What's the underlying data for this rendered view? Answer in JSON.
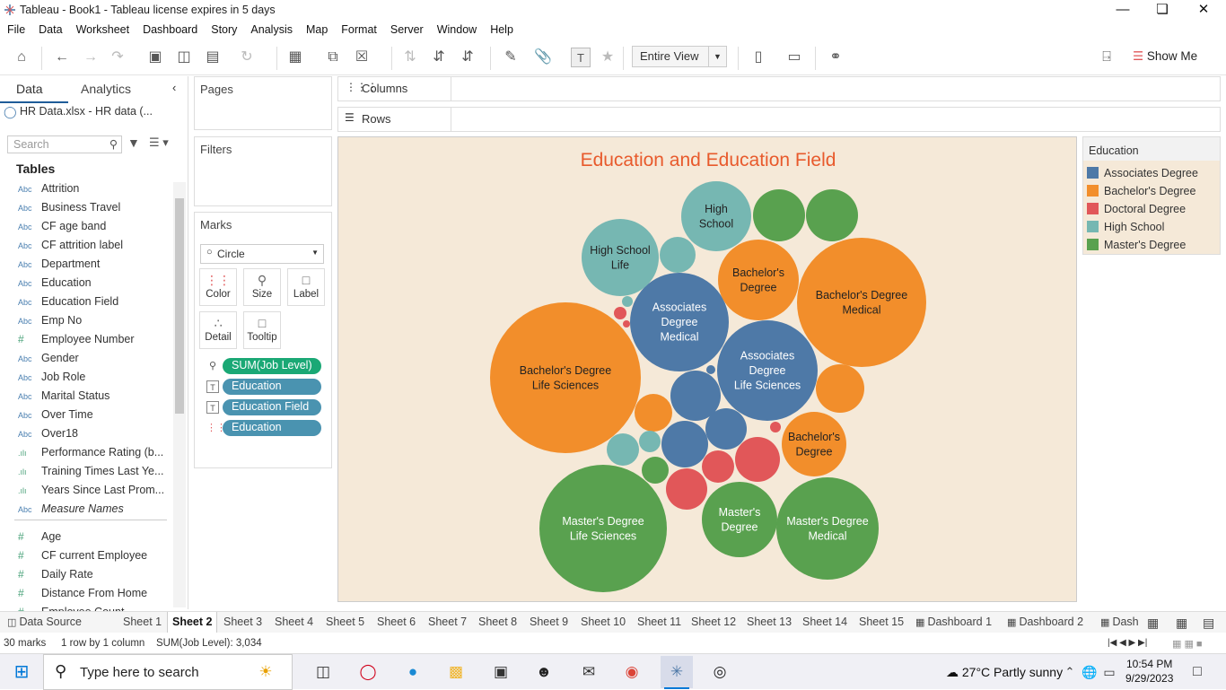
{
  "window": {
    "title": "Tableau - Book1 - Tableau license expires in 5 days"
  },
  "menu": [
    "File",
    "Data",
    "Worksheet",
    "Dashboard",
    "Story",
    "Analysis",
    "Map",
    "Format",
    "Server",
    "Window",
    "Help"
  ],
  "toolbar": {
    "view_mode": "Entire View",
    "show_me": "Show Me"
  },
  "left_panel": {
    "tab_data": "Data",
    "tab_analytics": "Analytics",
    "datasource": "HR Data.xlsx - HR data (...",
    "search_placeholder": "Search",
    "tables_heading": "Tables",
    "fields": [
      {
        "type": "Abc",
        "name": "Attrition"
      },
      {
        "type": "Abc",
        "name": "Business Travel"
      },
      {
        "type": "Abc",
        "name": "CF age band"
      },
      {
        "type": "Abc",
        "name": "CF attrition label"
      },
      {
        "type": "Abc",
        "name": "Department"
      },
      {
        "type": "Abc",
        "name": "Education"
      },
      {
        "type": "Abc",
        "name": "Education Field"
      },
      {
        "type": "Abc",
        "name": "Emp No"
      },
      {
        "type": "#",
        "name": "Employee Number"
      },
      {
        "type": "Abc",
        "name": "Gender"
      },
      {
        "type": "Abc",
        "name": "Job Role"
      },
      {
        "type": "Abc",
        "name": "Marital Status"
      },
      {
        "type": "Abc",
        "name": "Over Time"
      },
      {
        "type": "Abc",
        "name": "Over18"
      },
      {
        "type": ".ılı",
        "name": "Performance Rating (b..."
      },
      {
        "type": ".ılı",
        "name": "Training Times Last Ye..."
      },
      {
        "type": ".ılı",
        "name": "Years Since Last Prom..."
      },
      {
        "type": "Abc",
        "name": "Measure Names"
      },
      {
        "type": "#",
        "name": "Age"
      },
      {
        "type": "#",
        "name": "CF current Employee"
      },
      {
        "type": "#",
        "name": "Daily Rate"
      },
      {
        "type": "#",
        "name": "Distance From Home"
      },
      {
        "type": "#",
        "name": "Employee Count"
      }
    ]
  },
  "shelves": {
    "pages": "Pages",
    "filters": "Filters",
    "marks": "Marks",
    "columns": "Columns",
    "rows": "Rows",
    "mark_type": "Circle"
  },
  "marks_buttons": [
    "Color",
    "Size",
    "Label",
    "Detail",
    "Tooltip"
  ],
  "marks_pills": [
    {
      "label": "SUM(Job Level)",
      "color": "#1aa875"
    },
    {
      "label": "Education",
      "color": "#4a93b0"
    },
    {
      "label": "Education Field",
      "color": "#4a93b0"
    },
    {
      "label": "Education",
      "color": "#4a93b0"
    }
  ],
  "legend": {
    "title": "Education",
    "items": [
      {
        "label": "Associates Degree",
        "color": "#4e79a7"
      },
      {
        "label": "Bachelor's Degree",
        "color": "#f28e2b"
      },
      {
        "label": "Doctoral Degree",
        "color": "#e15759"
      },
      {
        "label": "High School",
        "color": "#76b7b2"
      },
      {
        "label": "Master's Degree",
        "color": "#59a14f"
      }
    ]
  },
  "chart_data": {
    "type": "bubble",
    "title": "Education and Education Field",
    "size_measure": "SUM(Job Level)",
    "total": "3,034",
    "mark_count": 30,
    "bubbles": [
      {
        "education": "Bachelor's Degree",
        "field": "Life Sciences",
        "label": "Bachelor's Degree\nLife Sciences",
        "size": 100
      },
      {
        "education": "Bachelor's Degree",
        "field": "Medical",
        "label": "Bachelor's Degree\nMedical",
        "size": 72
      },
      {
        "education": "Master's Degree",
        "field": "Life Sciences",
        "label": "Master's Degree\nLife Sciences",
        "size": 72
      },
      {
        "education": "Master's Degree",
        "field": "Medical",
        "label": "Master's Degree\nMedical",
        "size": 46
      },
      {
        "education": "Associates Degree",
        "field": "Medical",
        "label": "Associates\nDegree\nMedical",
        "size": 42
      },
      {
        "education": "Associates Degree",
        "field": "Life Sciences",
        "label": "Associates\nDegree\nLife Sciences",
        "size": 44
      },
      {
        "education": "Bachelor's Degree",
        "field": "",
        "label": "Bachelor's\nDegree",
        "size": 28
      },
      {
        "education": "Bachelor's Degree",
        "field": "",
        "label": "Bachelor's\nDegree",
        "size": 20
      },
      {
        "education": "Master's Degree",
        "field": "",
        "label": "Master's\nDegree",
        "size": 24
      },
      {
        "education": "High School",
        "field": "",
        "label": "High\nSchool",
        "size": 21
      },
      {
        "education": "High School",
        "field": "Life",
        "label": "High School\nLife",
        "size": 26
      },
      {
        "education": "Master's Degree",
        "field": "",
        "label": "",
        "size": 12
      },
      {
        "education": "Master's Degree",
        "field": "",
        "label": "",
        "size": 12
      },
      {
        "education": "Bachelor's Degree",
        "field": "",
        "label": "",
        "size": 10
      },
      {
        "education": "Associates Degree",
        "field": "",
        "label": "",
        "size": 11
      },
      {
        "education": "Associates Degree",
        "field": "",
        "label": "",
        "size": 9
      },
      {
        "education": "Associates Degree",
        "field": "",
        "label": "",
        "size": 9
      },
      {
        "education": "Doctoral Degree",
        "field": "",
        "label": "",
        "size": 8
      },
      {
        "education": "Doctoral Degree",
        "field": "",
        "label": "",
        "size": 8
      },
      {
        "education": "Doctoral Degree",
        "field": "",
        "label": "",
        "size": 5
      },
      {
        "education": "High School",
        "field": "",
        "label": "",
        "size": 6
      },
      {
        "education": "High School",
        "field": "",
        "label": "",
        "size": 5
      },
      {
        "education": "Bachelor's Degree",
        "field": "",
        "label": "",
        "size": 6
      },
      {
        "education": "Master's Degree",
        "field": "",
        "label": "",
        "size": 3
      },
      {
        "education": "High School",
        "field": "",
        "label": "",
        "size": 2
      },
      {
        "education": "Doctoral Degree",
        "field": "",
        "label": "",
        "size": 1
      },
      {
        "education": "Doctoral Degree",
        "field": "",
        "label": "",
        "size": 1
      },
      {
        "education": "Associates Degree",
        "field": "",
        "label": "",
        "size": 1
      },
      {
        "education": "High School",
        "field": "",
        "label": "",
        "size": 1
      },
      {
        "education": "Doctoral Degree",
        "field": "",
        "label": "",
        "size": 1
      }
    ]
  },
  "sheet_tabs": [
    "Data Source",
    "Sheet 1",
    "Sheet 2",
    "Sheet 3",
    "Sheet 4",
    "Sheet 5",
    "Sheet 6",
    "Sheet 7",
    "Sheet 8",
    "Sheet 9",
    "Sheet 10",
    "Sheet 11",
    "Sheet 12",
    "Sheet 13",
    "Sheet 14",
    "Sheet 15",
    "Dashboard 1",
    "Dashboard 2",
    "Dash"
  ],
  "active_tab": "Sheet 2",
  "status": {
    "marks": "30 marks",
    "rows": "1 row by 1 column",
    "sum": "SUM(Job Level): 3,034"
  },
  "taskbar": {
    "search_placeholder": "Type here to search",
    "weather": "27°C  Partly sunny",
    "time": "10:54 PM",
    "date": "9/29/2023"
  }
}
